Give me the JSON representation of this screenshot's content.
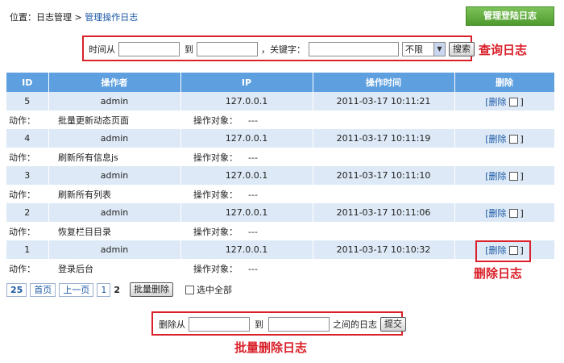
{
  "breadcrumb": {
    "prefix": "位置：日志管理 > ",
    "current": "管理操作日志"
  },
  "header_button": "管理登陆日志",
  "search": {
    "time_from_label": "时间从",
    "to_label": "到",
    "keyword_label": "，关键字：",
    "select_value": "不限",
    "search_button": "搜索"
  },
  "annotations": {
    "search": "查询日志",
    "delete": "删除日志",
    "batch": "批量删除日志"
  },
  "table": {
    "headers": [
      "ID",
      "操作者",
      "IP",
      "操作时间",
      "删除"
    ],
    "action_label": "动作：",
    "target_label": "操作对象：",
    "delete_open": "[删除",
    "delete_close": "]",
    "rows": [
      {
        "id": "5",
        "user": "admin",
        "ip": "127.0.0.1",
        "time": "2011-03-17 10:11:21",
        "action": "批量更新动态页面",
        "target": "---"
      },
      {
        "id": "4",
        "user": "admin",
        "ip": "127.0.0.1",
        "time": "2011-03-17 10:11:19",
        "action": "刷新所有信息js",
        "target": "---"
      },
      {
        "id": "3",
        "user": "admin",
        "ip": "127.0.0.1",
        "time": "2011-03-17 10:11:10",
        "action": "刷新所有列表",
        "target": "---"
      },
      {
        "id": "2",
        "user": "admin",
        "ip": "127.0.0.1",
        "time": "2011-03-17 10:11:06",
        "action": "恢复栏目目录",
        "target": "---"
      },
      {
        "id": "1",
        "user": "admin",
        "ip": "127.0.0.1",
        "time": "2011-03-17 10:10:32",
        "action": "登录后台",
        "target": "---"
      }
    ]
  },
  "pager": {
    "count": "25",
    "first": "首页",
    "prev": "上一页",
    "page1": "1",
    "page2": "2",
    "batch_delete": "批量删除",
    "select_all": "选中全部"
  },
  "batch": {
    "from_label": "删除从",
    "to_label": "到",
    "suffix": "之间的日志",
    "submit": "提交"
  }
}
